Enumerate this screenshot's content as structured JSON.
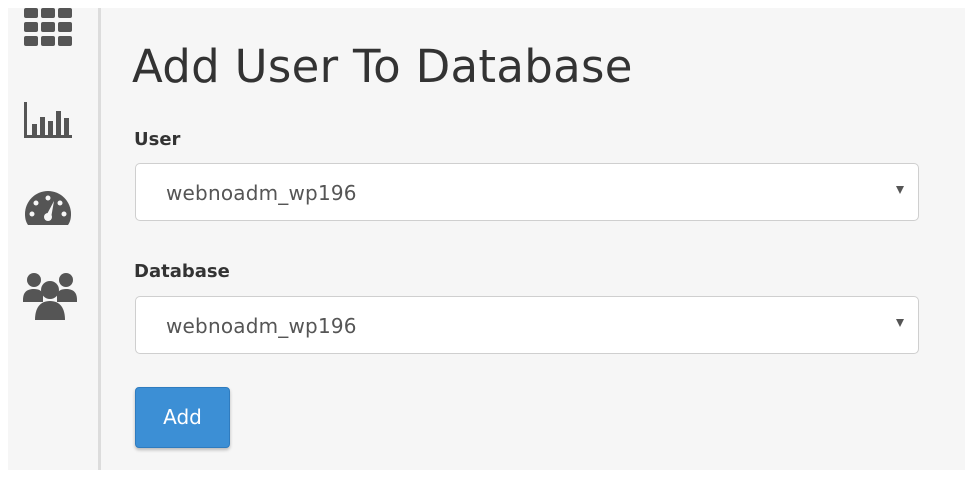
{
  "sidebar": {
    "icons": [
      "grid-icon",
      "bar-chart-icon",
      "gauge-icon",
      "users-icon"
    ]
  },
  "page": {
    "title": "Add User To Database"
  },
  "form": {
    "user": {
      "label": "User",
      "selected": "webnoadm_wp196"
    },
    "database": {
      "label": "Database",
      "selected": "webnoadm_wp196"
    },
    "add_button_label": "Add"
  },
  "colors": {
    "primary_button": "#3c8fd5",
    "background": "#f6f6f6",
    "icon": "#555555"
  }
}
